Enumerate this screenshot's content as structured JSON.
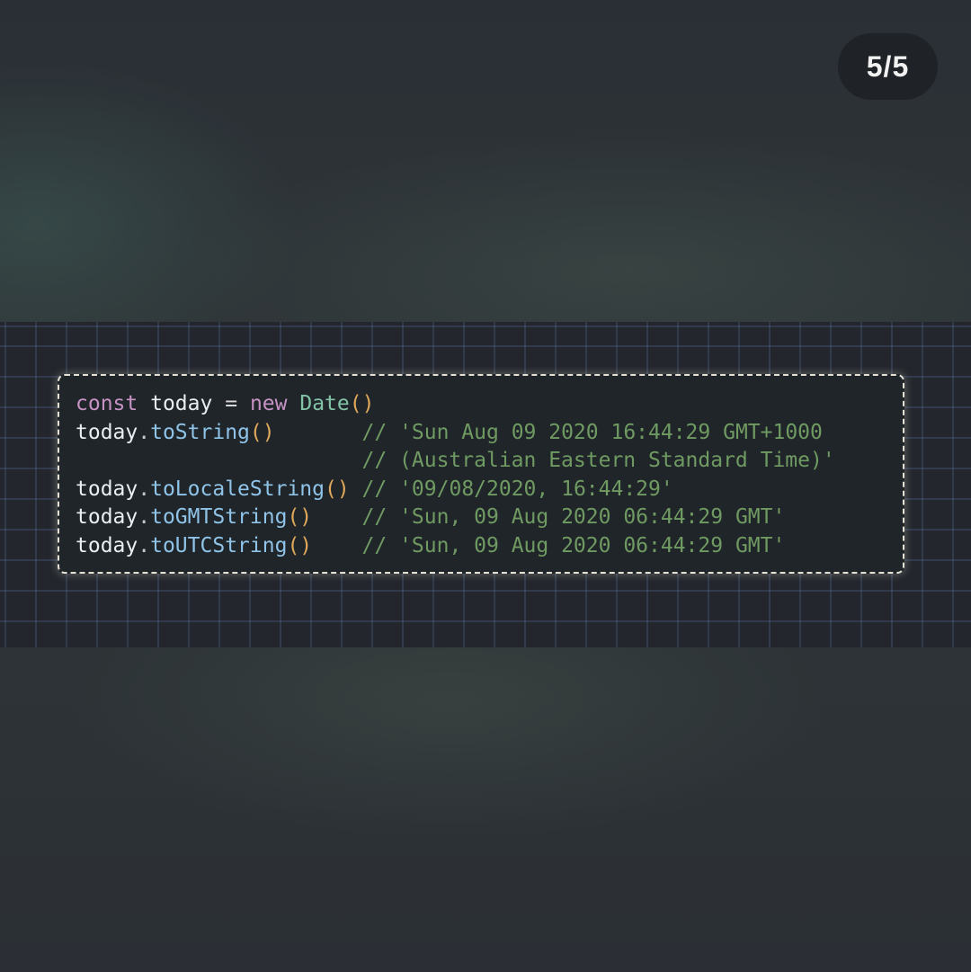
{
  "pager": {
    "counter": "5/5"
  },
  "code": {
    "line1": {
      "keyword": "const",
      "name": "today",
      "op": "=",
      "new_kw": "new",
      "class_name": "Date",
      "parens": "()"
    },
    "line2": {
      "obj": "today",
      "method": "toString",
      "parens": "()",
      "comment": "// 'Sun Aug 09 2020 16:44:29 GMT+1000"
    },
    "line3": {
      "comment": "// (Australian Eastern Standard Time)'"
    },
    "line4": {
      "obj": "today",
      "method": "toLocaleString",
      "parens": "()",
      "comment": "// '09/08/2020, 16:44:29'"
    },
    "line5": {
      "obj": "today",
      "method": "toGMTString",
      "parens": "()",
      "comment": "// 'Sun, 09 Aug 2020 06:44:29 GMT'"
    },
    "line6": {
      "obj": "today",
      "method": "toUTCString",
      "parens": "()",
      "comment": "// 'Sun, 09 Aug 2020 06:44:29 GMT'"
    }
  },
  "colors": {
    "keyword": "#c792c4",
    "class": "#83c3a8",
    "method": "#8fc4e8",
    "paren": "#e0a85a",
    "comment": "#6f9a62",
    "card_border": "#e6e1d6"
  }
}
